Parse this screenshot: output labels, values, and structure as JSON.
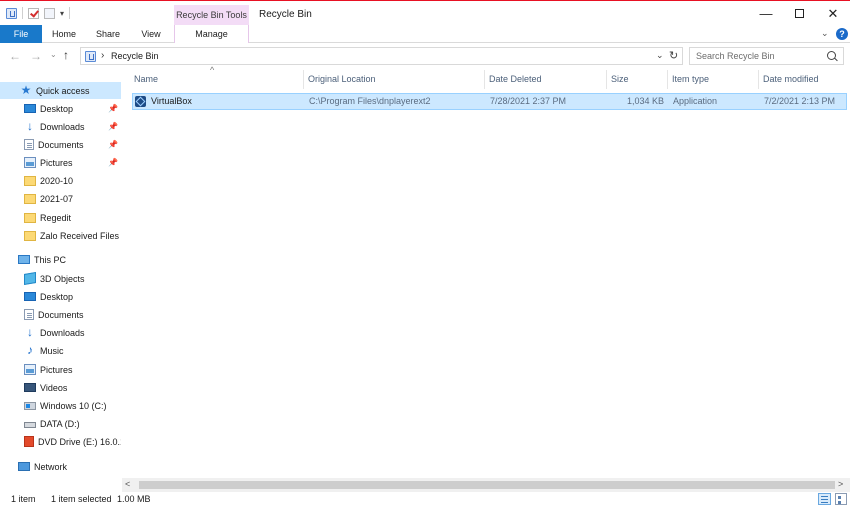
{
  "window": {
    "title": "Recycle Bin",
    "context_tab": "Recycle Bin Tools",
    "minimize_symbol": "—",
    "close_symbol": "✕"
  },
  "quick_access_toolbar": {
    "dropdown_symbol": "▾"
  },
  "ribbon": {
    "tabs": [
      {
        "label": "File"
      },
      {
        "label": "Home"
      },
      {
        "label": "Share"
      },
      {
        "label": "View"
      },
      {
        "label": "Manage"
      }
    ],
    "help_symbol": "?",
    "collapse_symbol": "⌄"
  },
  "nav_buttons": {
    "back": "←",
    "forward": "→",
    "recent": "⌄",
    "up": "↑"
  },
  "address": {
    "separator": "›",
    "path": "Recycle Bin",
    "dropdown": "⌄",
    "refresh": "↻"
  },
  "search": {
    "placeholder": "Search Recycle Bin",
    "value": ""
  },
  "navigation_pane": {
    "quick_access_label": "Quick access",
    "pin_symbol": "📌",
    "quick_access": [
      {
        "label": "Desktop",
        "pinned": true
      },
      {
        "label": "Downloads",
        "pinned": true
      },
      {
        "label": "Documents",
        "pinned": true
      },
      {
        "label": "Pictures",
        "pinned": true
      },
      {
        "label": "2020-10"
      },
      {
        "label": "2021-07"
      },
      {
        "label": "Regedit"
      },
      {
        "label": "Zalo Received Files"
      }
    ],
    "this_pc_label": "This PC",
    "this_pc": [
      {
        "label": "3D Objects"
      },
      {
        "label": "Desktop"
      },
      {
        "label": "Documents"
      },
      {
        "label": "Downloads"
      },
      {
        "label": "Music"
      },
      {
        "label": "Pictures"
      },
      {
        "label": "Videos"
      },
      {
        "label": "Windows 10 (C:)"
      },
      {
        "label": "DATA (D:)"
      },
      {
        "label": "DVD Drive (E:) 16.0.1"
      }
    ],
    "network_label": "Network"
  },
  "file_list": {
    "sort_symbol": "^",
    "columns": {
      "name": "Name",
      "original_location": "Original Location",
      "date_deleted": "Date Deleted",
      "size": "Size",
      "item_type": "Item type",
      "date_modified": "Date modified"
    },
    "rows": [
      {
        "name": "VirtualBox",
        "original_location": "C:\\Program Files\\dnplayerext2",
        "date_deleted": "7/28/2021 2:37 PM",
        "size": "1,034 KB",
        "item_type": "Application",
        "date_modified": "7/2/2021 2:13 PM"
      }
    ]
  },
  "scrollbar": {
    "left_arrow": "<",
    "right_arrow": ">"
  },
  "status_bar": {
    "item_count": "1 item",
    "selected": "1 item selected",
    "selected_size": "1.00 MB"
  },
  "colors": {
    "accent": "#1979ca",
    "context_tab_bg": "#f3dcf6",
    "selection_bg": "#cce8ff",
    "selection_border": "#99d1ff",
    "title_line": "#e81123"
  }
}
